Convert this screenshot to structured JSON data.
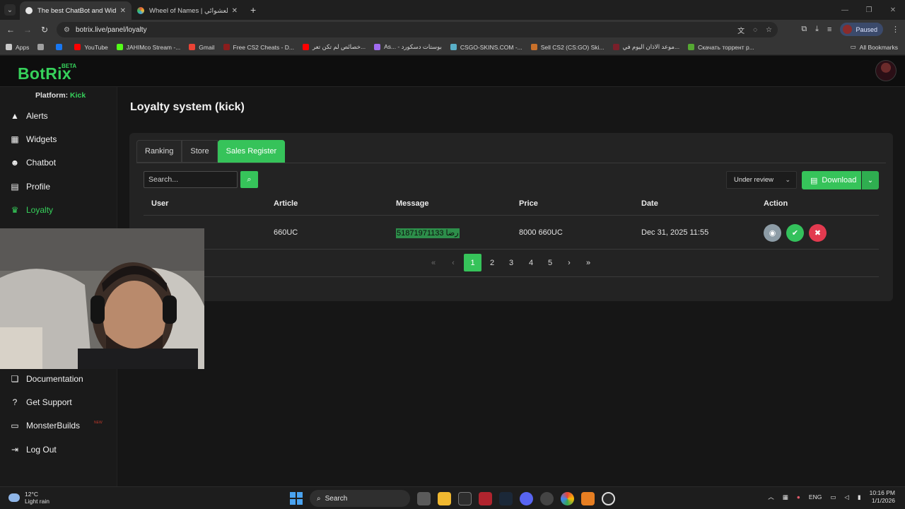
{
  "browser": {
    "tabs": [
      {
        "title": "The best ChatBot and Widgets",
        "active": true,
        "favicon_color": "#e6e6e6"
      },
      {
        "title": "Wheel of Names | إسم العشوائي",
        "active": false,
        "favicon_color": "#e05a3a"
      }
    ],
    "new_tab_icon": "+",
    "url": "botrix.live/panel/loyalty",
    "profile_status": "Paused",
    "bookmarks": [
      {
        "label": "Apps",
        "color": "#c9c9c9"
      },
      {
        "label": "",
        "color": "#a0a0a0"
      },
      {
        "label": "",
        "color": "#1877f2"
      },
      {
        "label": "YouTube",
        "color": "#ff0000"
      },
      {
        "label": "JAHIMco Stream -...",
        "color": "#53fc18"
      },
      {
        "label": "Gmail",
        "color": "#ea4335"
      },
      {
        "label": "Free CS2 Cheats - D...",
        "color": "#8b1d1d"
      },
      {
        "label": "خصائص لم تكن تعر...",
        "color": "#ff0000"
      },
      {
        "label": "As... - بوستات دسكورد",
        "color": "#a06bf0"
      },
      {
        "label": "CSGO-SKINS.COM -...",
        "color": "#5ab0c8"
      },
      {
        "label": "Sell CS2 (CS:GO) Ski...",
        "color": "#c8702a"
      },
      {
        "label": "موعد الاذان اليوم في...",
        "color": "#7a1f2a"
      },
      {
        "label": "Скачать торрент р...",
        "color": "#55a832"
      }
    ],
    "all_bookmarks": "All Bookmarks"
  },
  "app": {
    "logo": "BotRix",
    "beta": "BETA",
    "platform_label": "Platform:",
    "platform_value": "Kick",
    "nav": [
      {
        "label": "Alerts",
        "icon": "warning-icon"
      },
      {
        "label": "Widgets",
        "icon": "grid-icon"
      },
      {
        "label": "Chatbot",
        "icon": "robot-icon"
      },
      {
        "label": "Profile",
        "icon": "id-card-icon"
      },
      {
        "label": "Loyalty",
        "icon": "trophy-icon",
        "active": true
      }
    ],
    "nav_bottom": [
      {
        "label": "Documentation",
        "icon": "book-icon"
      },
      {
        "label": "Get Support",
        "icon": "question-icon"
      },
      {
        "label": "MonsterBuilds",
        "icon": "laptop-icon",
        "badge": "NEW"
      },
      {
        "label": "Log Out",
        "icon": "logout-icon"
      }
    ],
    "accent": "#36c35a"
  },
  "page": {
    "title": "Loyalty system (kick)",
    "tabs": [
      {
        "label": "Ranking"
      },
      {
        "label": "Store"
      },
      {
        "label": "Sales Register",
        "active": true
      }
    ],
    "search_placeholder": "Search...",
    "status_filter": "Under review",
    "download_label": "Download",
    "columns": [
      "User",
      "Article",
      "Message",
      "Price",
      "Date",
      "Action"
    ],
    "rows": [
      {
        "user": "",
        "article": "660UC",
        "message": "رضا 51871971133",
        "price": "8000 660UC",
        "date": "Dec 31, 2025 11:55"
      }
    ],
    "pagination": {
      "first": "«",
      "prev": "‹",
      "pages": [
        "1",
        "2",
        "3",
        "4",
        "5"
      ],
      "current": "1",
      "next": "›",
      "last": "»"
    }
  },
  "taskbar": {
    "temperature": "12°C",
    "weather": "Light rain",
    "search": "Search",
    "language": "ENG",
    "time": "10:16 PM",
    "date": "1/1/2026"
  }
}
